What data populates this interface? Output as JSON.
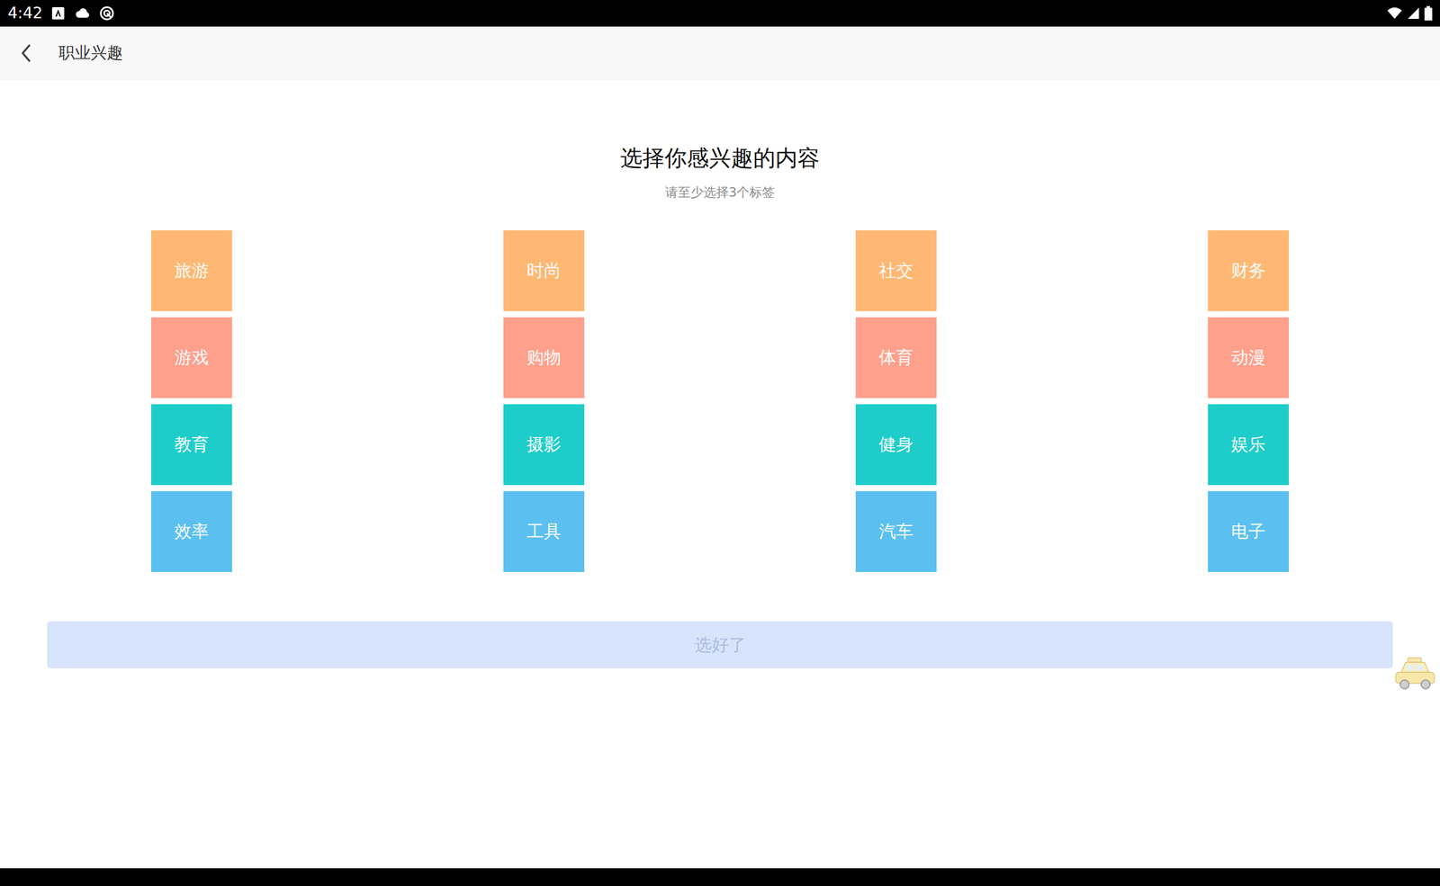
{
  "status_bar": {
    "time": "4:42"
  },
  "app_bar": {
    "title": "职业兴趣"
  },
  "heading": "选择你感兴趣的内容",
  "subtitle": "请至少选择3个标签",
  "tag_columns": [
    {
      "tags": [
        {
          "label": "旅游",
          "selected": false,
          "color": "#ffb873"
        },
        {
          "label": "游戏",
          "selected": false,
          "color": "#ffa08c"
        },
        {
          "label": "教育",
          "selected": false,
          "color": "#1ecdc9"
        },
        {
          "label": "效率",
          "selected": false,
          "color": "#5bc0f0"
        }
      ]
    },
    {
      "tags": [
        {
          "label": "时尚",
          "selected": false,
          "color": "#ffb873"
        },
        {
          "label": "购物",
          "selected": false,
          "color": "#ffa08c"
        },
        {
          "label": "摄影",
          "selected": false,
          "color": "#1ecdc9"
        },
        {
          "label": "工具",
          "selected": false,
          "color": "#5bc0f0"
        }
      ]
    },
    {
      "tags": [
        {
          "label": "社交",
          "selected": false,
          "color": "#ffb873"
        },
        {
          "label": "体育",
          "selected": false,
          "color": "#ffa08c"
        },
        {
          "label": "健身",
          "selected": false,
          "color": "#1ecdc9"
        },
        {
          "label": "汽车",
          "selected": false,
          "color": "#5bc0f0"
        }
      ]
    },
    {
      "tags": [
        {
          "label": "财务",
          "selected": false,
          "color": "#ffb873"
        },
        {
          "label": "动漫",
          "selected": false,
          "color": "#ffa08c"
        },
        {
          "label": "娱乐",
          "selected": false,
          "color": "#1ecdc9"
        },
        {
          "label": "电子",
          "selected": false,
          "color": "#5bc0f0"
        }
      ]
    }
  ],
  "confirm_button": {
    "label": "选好了",
    "disabled": true
  }
}
